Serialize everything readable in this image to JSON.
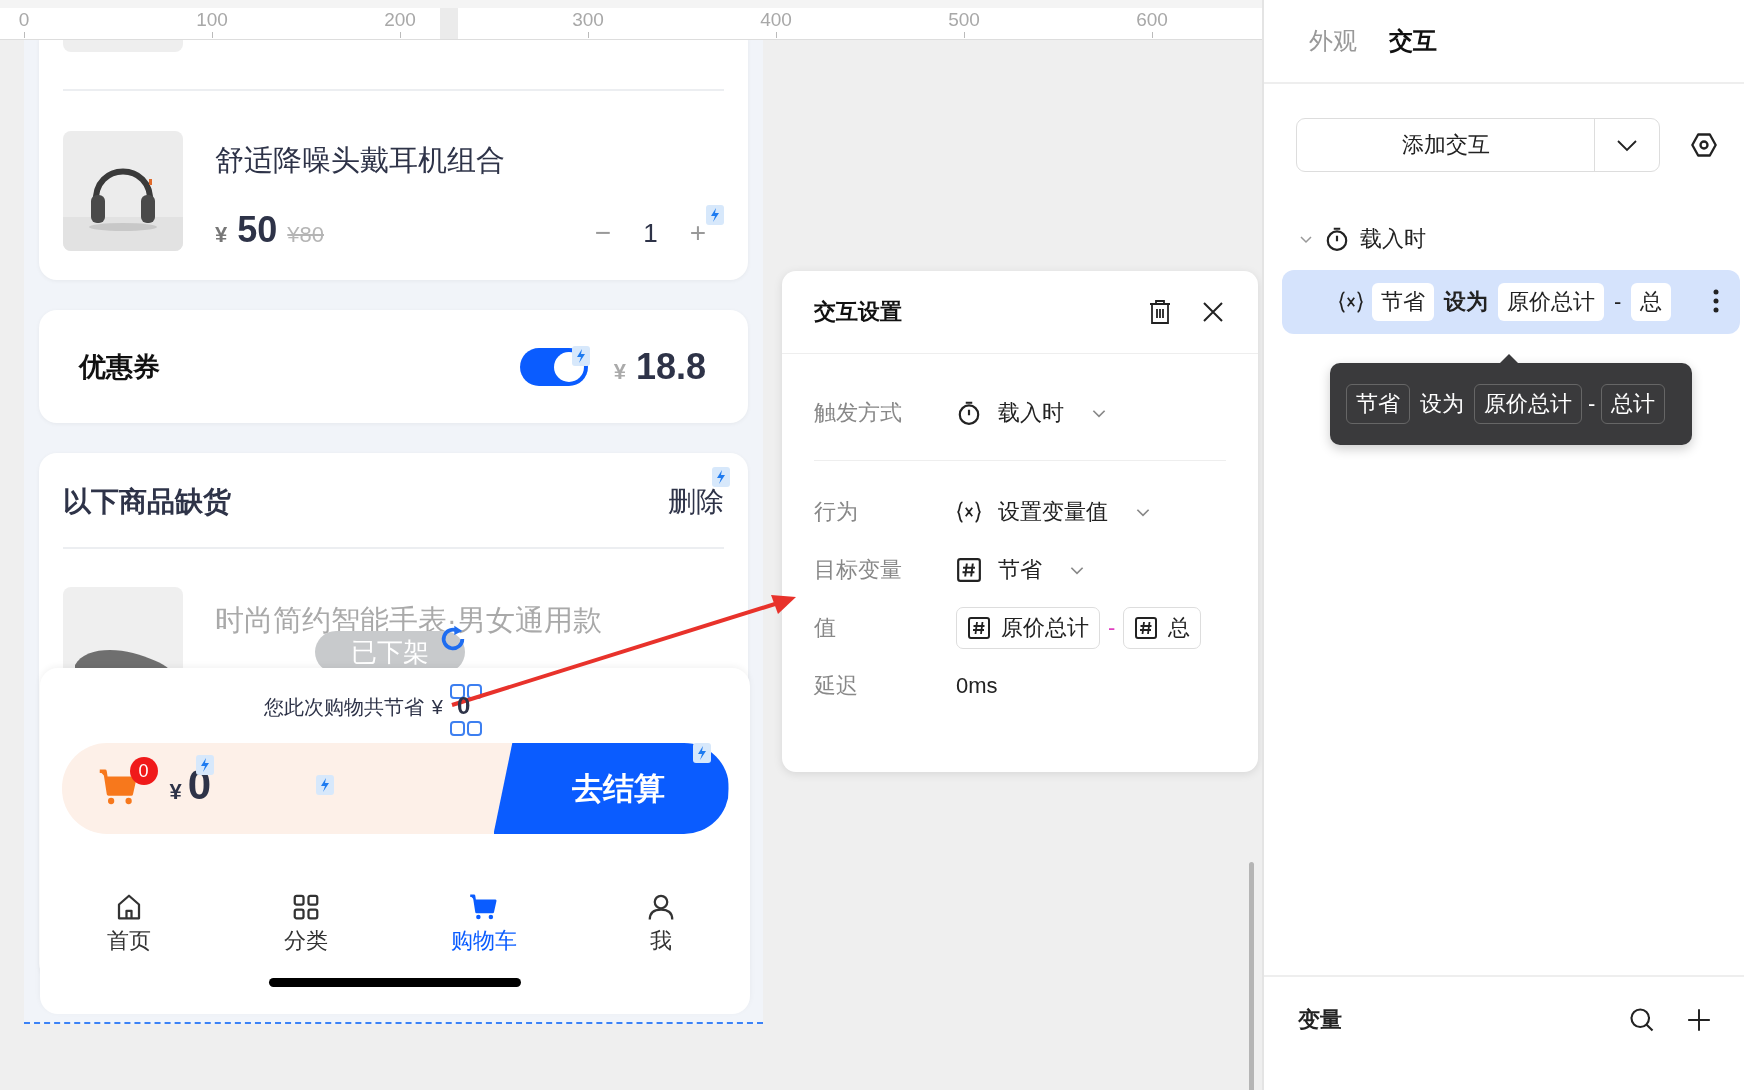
{
  "ruler": {
    "ticks": [
      "0",
      "100",
      "200",
      "300",
      "400",
      "500",
      "600"
    ]
  },
  "cart": {
    "product": {
      "title": "舒适降噪头戴耳机组合",
      "currency": "¥",
      "price": "50",
      "original_price": "80",
      "minus": "−",
      "quantity": "1",
      "plus": "+"
    },
    "coupon": {
      "label": "优惠券",
      "enabled": true,
      "currency": "¥",
      "amount": "18.8"
    },
    "out_of_stock": {
      "title": "以下商品缺货",
      "action": "删除",
      "items": [
        {
          "name": "时尚简约智能手表·男女通用款",
          "status": "已下架"
        }
      ]
    },
    "savings": {
      "text": "您此次购物共节省",
      "currency": "¥",
      "value": "0"
    },
    "checkout": {
      "cart_count": "0",
      "currency": "¥",
      "total": "0",
      "button": "去结算"
    },
    "tabbar": [
      {
        "label": "首页",
        "selected": false
      },
      {
        "label": "分类",
        "selected": false
      },
      {
        "label": "购物车",
        "selected": true
      },
      {
        "label": "我",
        "selected": false
      }
    ]
  },
  "dialog": {
    "title": "交互设置",
    "fields": [
      {
        "kind": "trigger",
        "label": "触发方式",
        "value": "载入时"
      },
      {
        "kind": "action",
        "label": "行为",
        "value": "设置变量值"
      },
      {
        "kind": "variable",
        "label": "目标变量",
        "value": "节省"
      },
      {
        "kind": "expression",
        "label": "值",
        "operands": [
          "原价总计",
          "总"
        ],
        "operator": "-"
      },
      {
        "kind": "text",
        "label": "延迟",
        "value": "0ms"
      }
    ]
  },
  "panel": {
    "tabs": [
      {
        "label": "外观",
        "selected": false
      },
      {
        "label": "交互",
        "selected": true
      }
    ],
    "add_button": "添加交互",
    "events": [
      {
        "label": "载入时",
        "expanded": true,
        "actions": [
          {
            "variable": "节省",
            "verb": "设为",
            "operands": [
              "原价总计",
              "总"
            ],
            "operator": "-",
            "selected": true
          }
        ]
      }
    ],
    "tooltip": {
      "variable": "节省",
      "verb": "设为",
      "operands": [
        "原价总计",
        "总计"
      ],
      "operator": "-"
    },
    "variables": {
      "title": "变量"
    }
  }
}
